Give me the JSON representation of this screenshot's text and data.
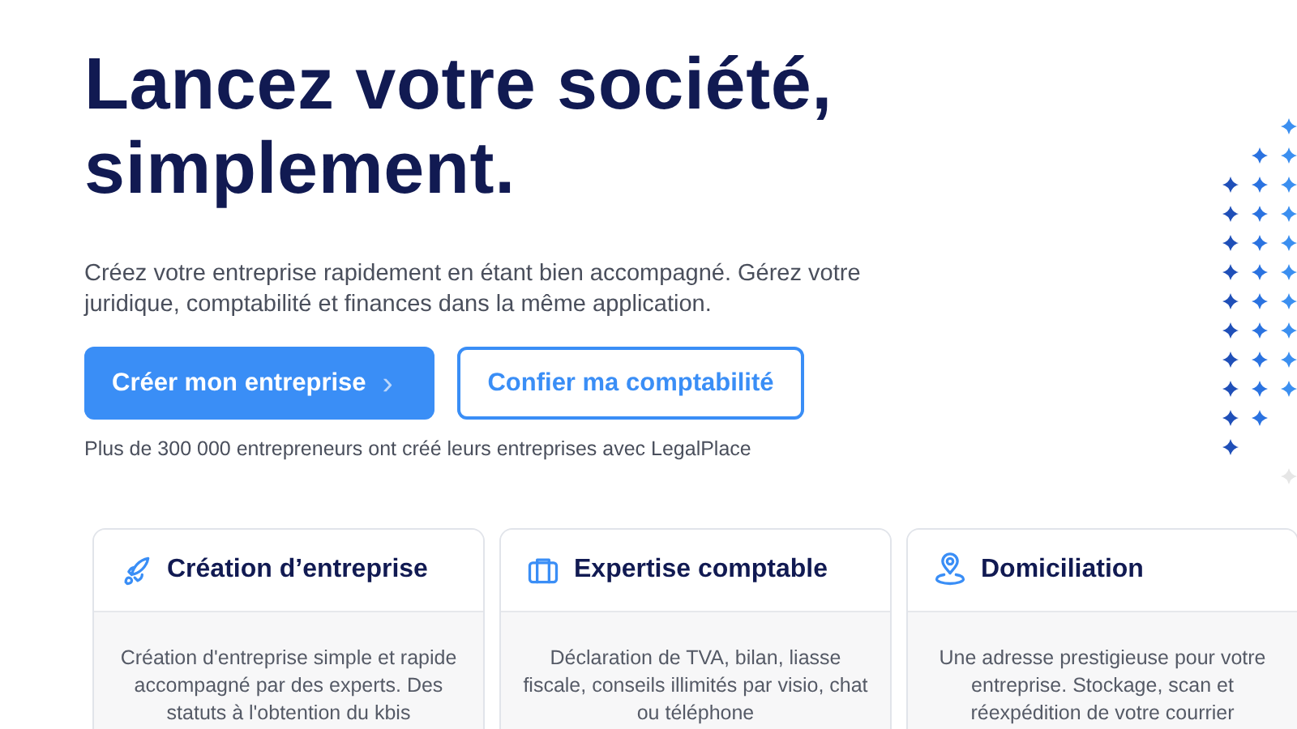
{
  "hero": {
    "title": "Lancez votre société, simplement.",
    "subtitle": "Créez votre entreprise rapidement en étant bien accompagné. Gérez votre juridique, comptabilité et finances dans la même application.",
    "primary_button": {
      "label": "Créer mon entreprise",
      "chevron": "›"
    },
    "secondary_button": {
      "label": "Confier ma comptabilité"
    },
    "note": "Plus de 300 000 entrepreneurs ont créé leurs entreprises avec LegalPlace"
  },
  "cards": [
    {
      "kind": "rocket",
      "title": "Création d’entreprise",
      "text": "Création d'entreprise simple et rapide accompagné par des experts. Des statuts à l'obtention du kbis"
    },
    {
      "kind": "briefcase",
      "title": "Expertise comptable",
      "text": "Déclaration de TVA, bilan, liasse fiscale, conseils illimités par visio, chat ou téléphone"
    },
    {
      "kind": "pin",
      "title": "Domiciliation",
      "text": "Une adresse prestigieuse pour votre entreprise. Stockage, scan et réexpédition de votre courrier"
    }
  ]
}
